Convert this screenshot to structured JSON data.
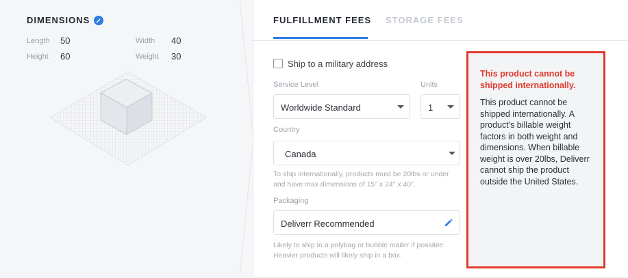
{
  "dimensions": {
    "title": "DIMENSIONS",
    "info_icon": "info-icon",
    "length_label": "Length",
    "length_value": "50",
    "width_label": "Width",
    "width_value": "40",
    "height_label": "Height",
    "height_value": "60",
    "weight_label": "Weight",
    "weight_value": "30"
  },
  "tabs": {
    "fulfillment": "FULFILLMENT FEES",
    "storage": "STORAGE FEES"
  },
  "form": {
    "military_checkbox_label": "Ship to a military address",
    "service_level_label": "Service Level",
    "service_level_value": "Worldwide Standard",
    "units_label": "Units",
    "units_value": "1",
    "country_label": "Country",
    "country_value": "Canada",
    "country_help_1": "To ship internationally, products must be 20lbs or under",
    "country_help_2": "and have max dimensions of 15\" x 24\" x 40\".",
    "packaging_label": "Packaging",
    "packaging_value": "Deliverr Recommended",
    "packaging_help_1": "Likely to ship in a polybag or bubble mailer if possible.",
    "packaging_help_2": "Heavier products will likely ship in a box."
  },
  "alert": {
    "title_1": "This product cannot be",
    "title_2": "shipped internationally.",
    "body": [
      "This product cannot be",
      "shipped internationally. A",
      "product's billable weight",
      "factors in both weight and",
      "dimensions. When billable",
      "weight is over 20lbs, Deliverr",
      "cannot ship the product",
      "outside the United States."
    ]
  },
  "colors": {
    "accent": "#2f7de1",
    "alert_red": "#e0392d"
  }
}
